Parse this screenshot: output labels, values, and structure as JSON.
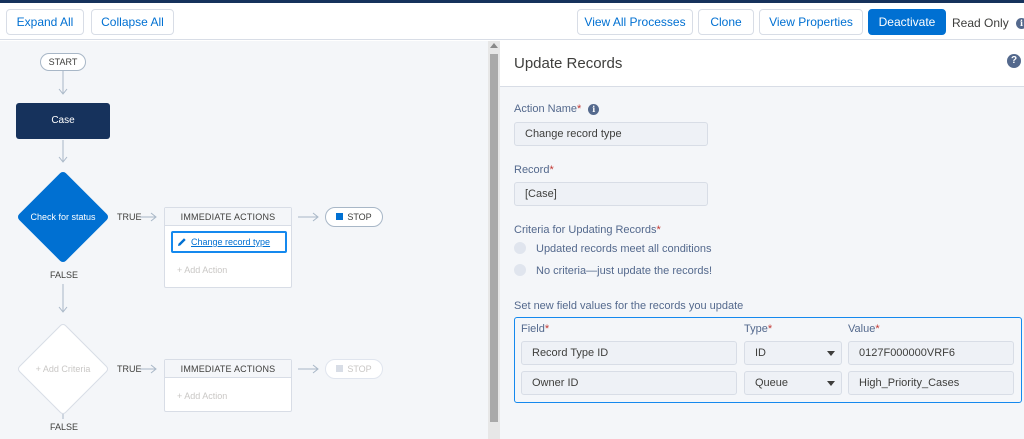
{
  "toolbar": {
    "expand_all": "Expand All",
    "collapse_all": "Collapse All",
    "view_all_processes": "View All Processes",
    "clone": "Clone",
    "view_properties": "View Properties",
    "deactivate": "Deactivate",
    "read_only": "Read Only",
    "info_icon": "info-icon"
  },
  "canvas": {
    "start": "START",
    "object_node": "Case",
    "criteria_1": {
      "label": "Check for status",
      "true_label": "TRUE",
      "false_label": "FALSE",
      "actions_header": "IMMEDIATE ACTIONS",
      "action_item": "Change record type",
      "add_action": "Add Action",
      "stop": "STOP"
    },
    "criteria_2": {
      "label": "Add Criteria",
      "true_label": "TRUE",
      "false_label": "FALSE",
      "actions_header": "IMMEDIATE ACTIONS",
      "add_action": "Add Action",
      "stop": "STOP"
    }
  },
  "panel": {
    "title": "Update Records",
    "help_icon": "help-icon",
    "action_name_label": "Action Name",
    "action_name_value": "Change record type",
    "record_label": "Record",
    "record_value": "[Case]",
    "criteria_label": "Criteria for Updating Records",
    "criteria_options": [
      "Updated records meet all conditions",
      "No criteria—just update the records!"
    ],
    "field_values_label": "Set new field values for the records you update",
    "table": {
      "headers": {
        "field": "Field",
        "type": "Type",
        "value": "Value"
      },
      "rows": [
        {
          "field": "Record Type ID",
          "type": "ID",
          "value": "0127F000000VRF6"
        },
        {
          "field": "Owner ID",
          "type": "Queue",
          "value": "High_Priority_Cases"
        }
      ]
    }
  },
  "colors": {
    "brand": "#0070d2",
    "navy": "#16325c",
    "focus": "#1589ee",
    "required": "#c23934"
  }
}
